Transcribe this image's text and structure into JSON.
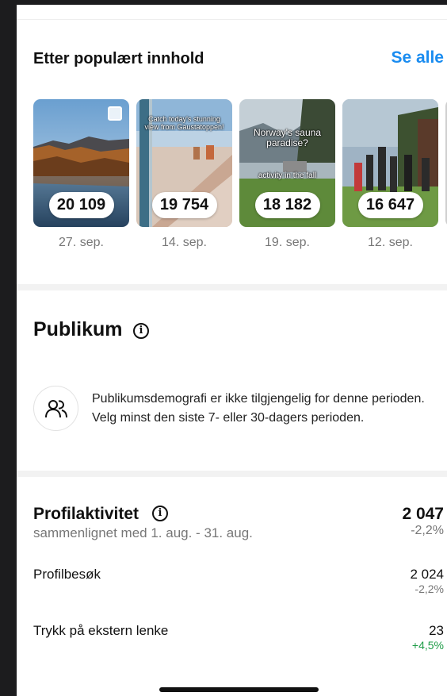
{
  "popular": {
    "title": "Etter populært innhold",
    "see_all": "Se alle",
    "items": [
      {
        "views": "20 109",
        "date": "27. sep.",
        "overlay": "",
        "multi": true
      },
      {
        "views": "19 754",
        "date": "14. sep.",
        "overlay": "Catch today's stunning view from Gaustatoppen!",
        "multi": false
      },
      {
        "views": "18 182",
        "date": "19. sep.",
        "overlay": "Norway's sauna paradise?",
        "overlay2": "activity in the fall",
        "multi": false
      },
      {
        "views": "16 647",
        "date": "12. sep.",
        "overlay": "",
        "multi": false
      }
    ]
  },
  "audience": {
    "title": "Publikum",
    "info_icon": "info-icon",
    "people_icon": "people-icon",
    "message": "Publikumsdemografi er ikke tilgjengelig for denne perioden. Velg minst den siste 7- eller 30-dagers perioden."
  },
  "profile_activity": {
    "title": "Profilaktivitet",
    "comparison": "sammenlignet med 1. aug. - 31. aug.",
    "total": "2 047",
    "total_change": "-2,2%",
    "rows": [
      {
        "label": "Profilbesøk",
        "value": "2 024",
        "change": "-2,2%"
      },
      {
        "label": "Trykk på ekstern lenke",
        "value": "23",
        "change": "+4,5%"
      }
    ]
  },
  "colors": {
    "accent": "#1a8cf0",
    "positive": "#1f9d48",
    "muted": "#777777"
  }
}
